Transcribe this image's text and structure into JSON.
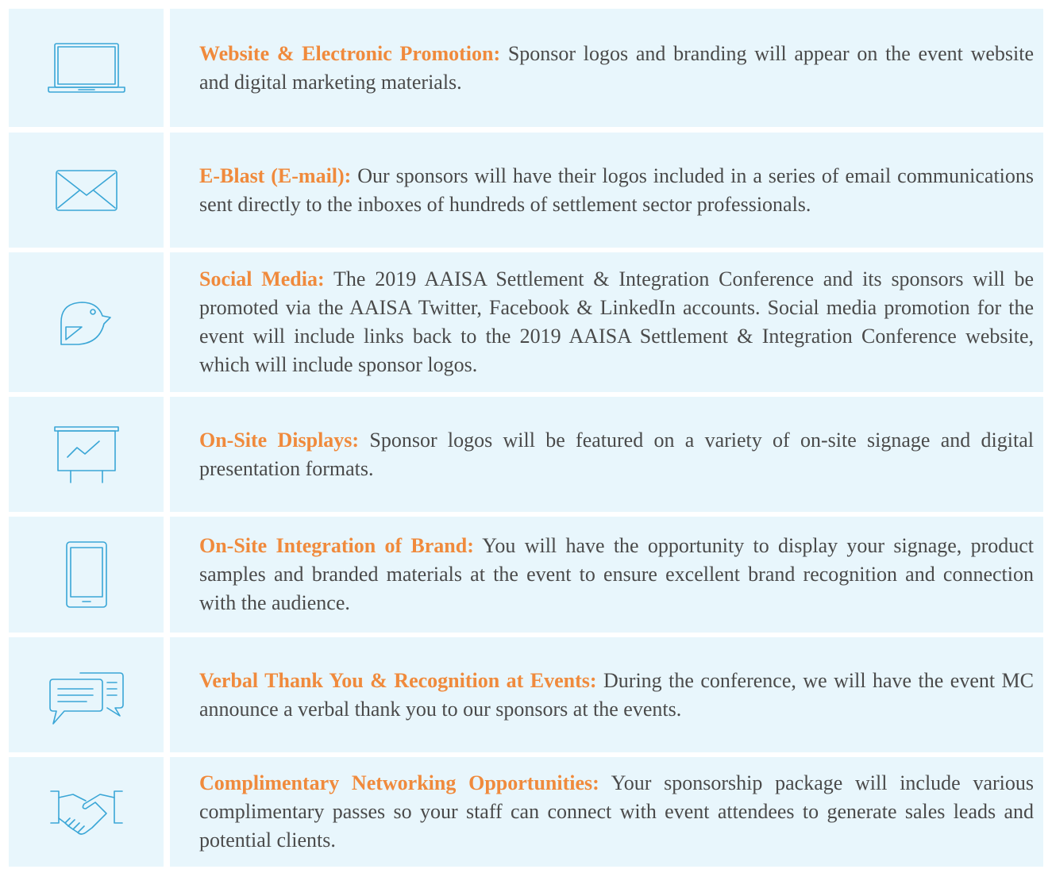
{
  "items": [
    {
      "icon": "laptop-icon",
      "title": "Website & Electronic Promotion:",
      "body": "Sponsor logos and branding will appear on the event website and digital marketing materials."
    },
    {
      "icon": "envelope-icon",
      "title": "E-Blast (E-mail):",
      "body": "Our sponsors will have their logos included in a series of email communications sent directly to the inboxes of hundreds of settlement sector professionals."
    },
    {
      "icon": "bird-icon",
      "title": "Social Media:",
      "body": "The 2019 AAISA Settlement & Integration Conference and its sponsors will be promoted via the AAISA Twitter, Facebook & LinkedIn accounts. Social media promotion for the event will include links back to the 2019 AAISA Settlement & Integration Conference website, which will include sponsor logos."
    },
    {
      "icon": "presentation-board-icon",
      "title": "On-Site Displays:",
      "body": "Sponsor logos will be featured on a variety of on-site signage and digital presentation formats."
    },
    {
      "icon": "tablet-icon",
      "title": "On-Site Integration of Brand:",
      "body": "You will have the opportunity to display your signage, product samples and branded materials at the event to ensure excellent brand recognition and connection with the audience."
    },
    {
      "icon": "speech-bubbles-icon",
      "title": "Verbal Thank You & Recognition at Events:",
      "body": "During the conference, we will have the event MC announce a verbal thank you to our sponsors at the events."
    },
    {
      "icon": "handshake-icon",
      "title": "Complimentary Networking Opportunities:",
      "body": "Your sponsorship package will include various complimentary passes so your staff can connect with event attendees to generate sales leads and potential clients."
    }
  ],
  "colors": {
    "cell_bg": "#e8f6fc",
    "heading": "#f08a3c",
    "body_text": "#4a4a4a",
    "icon": "#3aa6d6"
  }
}
